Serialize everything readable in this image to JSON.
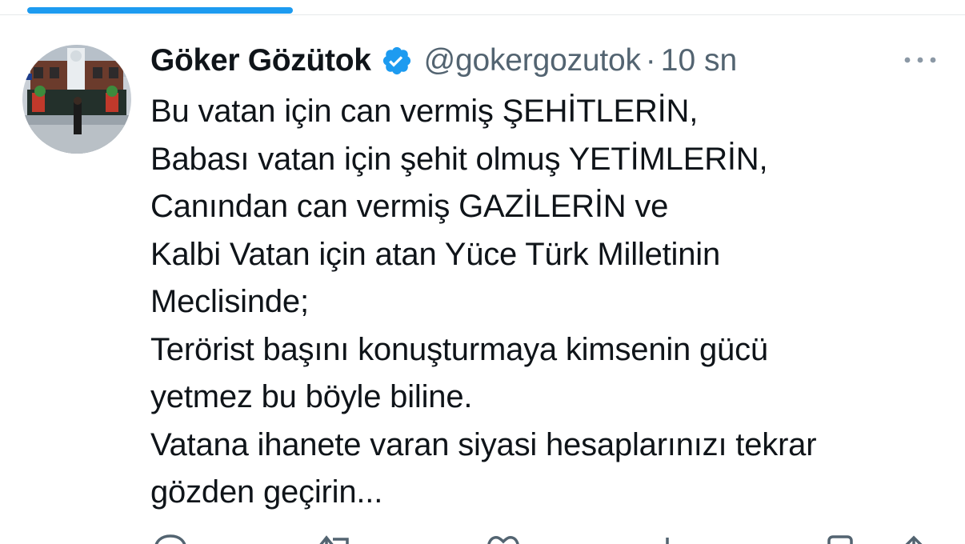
{
  "tweet": {
    "author": {
      "display_name": "Göker Gözütok",
      "handle": "@gokergozutok",
      "verified": true
    },
    "separator": "·",
    "time": "10 sn",
    "text_lines": [
      "Bu vatan için can vermiş ŞEHİTLERİN,",
      "Babası vatan için şehit olmuş YETİMLERİN,",
      "Canından can vermiş GAZİLERİN ve",
      "Kalbi Vatan için atan Yüce Türk Milletinin",
      "Meclisinde;",
      "Terörist başını konuşturmaya kimsenin gücü",
      "yetmez bu böyle biline.",
      "Vatana ihanete varan siyasi hesaplarınızı tekrar",
      "gözden geçirin..."
    ],
    "actions": [
      "reply-icon",
      "retweet-icon",
      "like-icon",
      "views-icon",
      "bookmark-icon",
      "share-icon"
    ]
  },
  "colors": {
    "accent": "#1d9bf0",
    "text": "#0f1419",
    "secondary": "#536471"
  }
}
